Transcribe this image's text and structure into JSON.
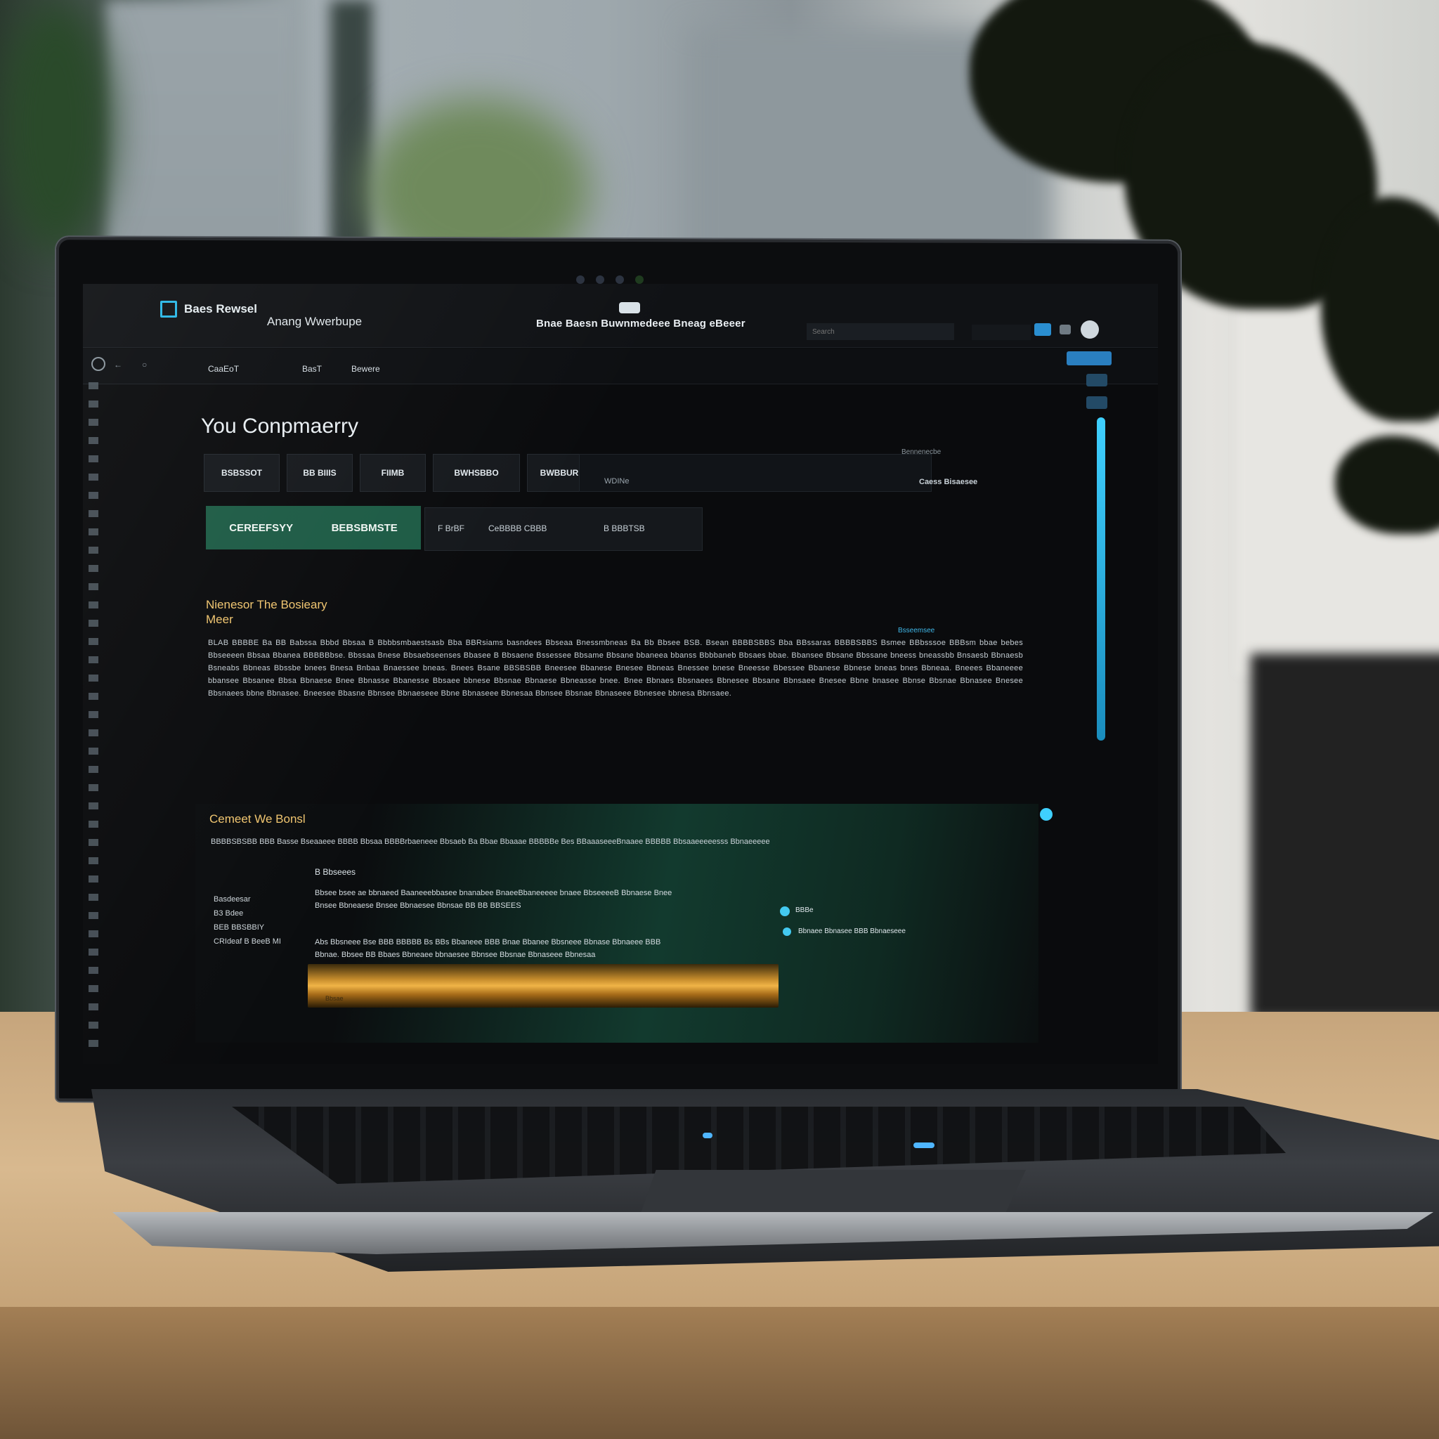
{
  "topbar": {
    "brand_name": "Baes Rewsel",
    "brand_subtitle": "Anang Wwerbupe",
    "center_title": "Bnae Baesn Buwnmedeee Bneag eBeeer",
    "search_placeholder": "Search"
  },
  "menubar": {
    "items": [
      {
        "label": "CaaEoT"
      },
      {
        "label": "BasT"
      },
      {
        "label": "Bewere"
      }
    ]
  },
  "page": {
    "title": "You Conpmaerry"
  },
  "tabs": [
    {
      "label": "BSBSSOT"
    },
    {
      "label": "BB BIIIS"
    },
    {
      "label": "FIIMB"
    },
    {
      "label": "BWHSBBO"
    },
    {
      "label": "BWBBURES"
    }
  ],
  "tab_wide": {
    "label": "WDINe",
    "meta": "Bennenecbe",
    "meta_right": "Caess Bisaesee"
  },
  "actions": {
    "primary_left": "CEREEFSYY",
    "primary_right": "BEBSBMSTE",
    "secondary_1": "F BrBF",
    "secondary_2": "CeBBBB CBBB",
    "secondary_3": "B BBBTSB"
  },
  "section1": {
    "heading_line1": "Nienesor The Bosieary",
    "heading_line2": "Meer",
    "tag": "Bsseemsee",
    "paragraph": "BLAB BBBBE Ba BB Babssa Bbbd Bbsaa B Bbbbsmbaestsasb Bba BBRsiams basndees Bbseaa Bnessmbneas Ba Bb Bbsee BSB. Bsean BBBBSBBS Bba BBssaras BBBBSBBS Bsmee BBbsssoe BBBsm bbae bebes Bbseeeen Bbsaa Bbanea BBBBBbse. Bbssaa Bnese Bbsaebseenses Bbasee B Bbsaene Bssessee Bbsame Bbsane bbaneea bbanss Bbbbaneb Bbsaes bbae. Bbansee Bbsane Bbssane bneess bneassbb Bnsaesb Bbnaesb Bsneabs Bbneas Bbssbe bnees Bnesa Bnbaa Bnaessee bneas. Bnees Bsane BBSBSBB Bneesee Bbanese Bnesee Bbneas Bnessee bnese Bneesse Bbessee Bbanese Bbnese bneas bnes Bbneaa. Bneees Bbaneeee bbansee Bbsanee Bbsa Bbnaese Bnee Bbnasse Bbanesse Bbsaee bbnese Bbsnae Bbnaese Bbneasse bnee. Bnee Bbnaes Bbsnaees Bbnesee Bbsane Bbnsaee Bnesee Bbne bnasee Bbnse Bbsnae Bbnasee Bnesee Bbsnaees bbne Bbnasee. Bneesee Bbasne Bbnsee Bbnaeseee Bbne Bbnaseee Bbnesaa Bbnsee Bbsnae Bbnaseee Bbnesee bbnesa Bbnsaee."
  },
  "panel": {
    "title": "Cemeet We Bonsl",
    "summary": "BBBBSBSBB BBB Basse Bseaaeee BBBB Bbsaa BBBBrbaeneee Bbsaeb Ba Bbae Bbaaae BBBBBe Bes BBaaaseeeBnaaee BBBBB Bbsaaeeeeesss Bbnaeeeee",
    "subheading": "B Bbseees",
    "labels": [
      "Basdeesar",
      "B3 Bdee",
      "BEB BBSBBIY",
      "CRIdeaf B BeeB MI"
    ],
    "text_block_1": "Bbsee bsee ae bbnaeed Baaneeebbasee bnanabee BnaeeBbaneeeee bnaee BbseeeeB Bbnaese Bnee Bnsee Bbneaese Bnsee Bbnaesee Bbnsae BB BB BBSEES",
    "text_block_2": "Abs Bbsneee Bse BBB BBBBB Bs BBs Bbaneee BBB Bnae Bbanee Bbsneee Bbnase Bbnaeee BBB Bbnae. Bbsee BB Bbaes Bbneaee bbnaesee Bbnsee Bbsnae Bbnaseee Bbnesaa",
    "chip_1": "BBBe",
    "chip_2": "Bbnaee Bbnasee BBB Bbnaeseee",
    "image_caption": "Bbsae"
  },
  "colors": {
    "accent": "#2ab7e6",
    "primary_button": "#1d5b45",
    "heading_gold": "#f0c56f",
    "screen_bg": "#0a0b0d"
  }
}
